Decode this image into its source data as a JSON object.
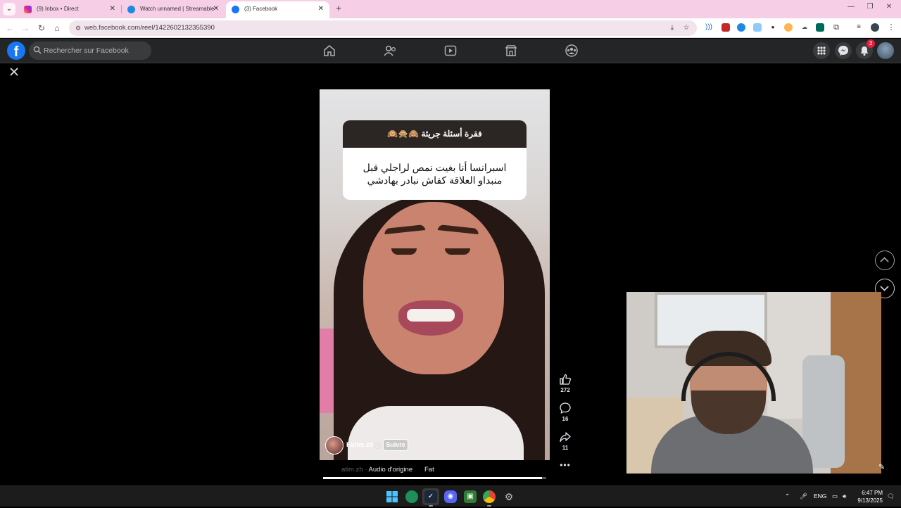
{
  "browser": {
    "tabs": [
      {
        "title": "(9) Inbox • Direct",
        "favicon": "instagram-icon",
        "active": false
      },
      {
        "title": "Watch unnamed | Streamable",
        "favicon": "streamable-icon",
        "active": false
      },
      {
        "title": "(3) Facebook",
        "favicon": "facebook-icon",
        "active": true
      }
    ],
    "address": {
      "host": "web.facebook.com",
      "path": "/reel/1422602132355390"
    }
  },
  "facebook": {
    "search_placeholder": "Rechercher sur Facebook",
    "notification_count": "3",
    "nav_icons": [
      "home-icon",
      "friends-icon",
      "video-icon",
      "marketplace-icon",
      "groups-icon"
    ]
  },
  "reel": {
    "question_header": "فقرة أسئلة جريئة 🙈🙊🙉",
    "question_text": "اسبرانسا أنا بغيت نمص لراجلي قبل منبداو العلاقة كفاش نبادر بهادشي",
    "author_name": "Fatim.zh",
    "follow_label": "Suivre",
    "audio_faded": "atim.zh · ",
    "audio_label": "Audio d'origine",
    "audio_next": "Fat",
    "likes": "272",
    "comments": "16",
    "shares": "11",
    "progress": 0.98
  },
  "taskbar": {
    "language": "ENG",
    "time": "6:47 PM",
    "date": "9/13/2025"
  },
  "colors": {
    "facebook_blue": "#1877f2",
    "tab_strip": "#f6cfe6",
    "fb_bar": "#242526"
  }
}
